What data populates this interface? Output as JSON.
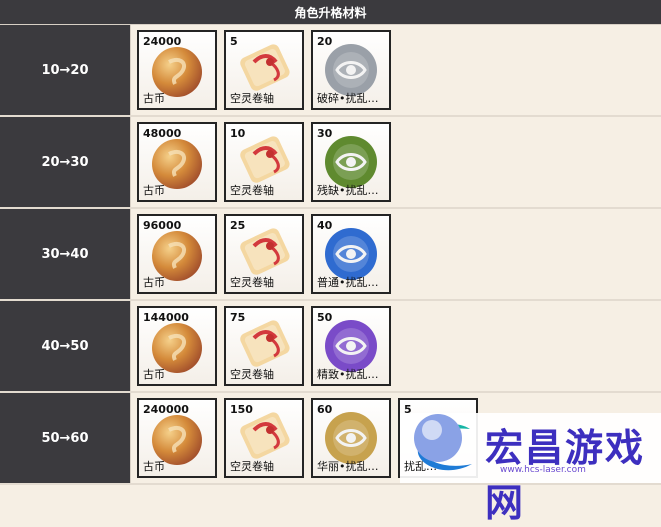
{
  "header": {
    "title": "角色升格材料"
  },
  "rows": [
    {
      "label": "10→20",
      "items": [
        {
          "count": "24000",
          "name": "古币",
          "icon": "coin-icon"
        },
        {
          "count": "5",
          "name": "空灵卷轴",
          "icon": "scroll-icon"
        },
        {
          "count": "20",
          "name": "破碎•扰乱…",
          "icon": "seal-icon",
          "color": "#9aa0a8"
        }
      ]
    },
    {
      "label": "20→30",
      "items": [
        {
          "count": "48000",
          "name": "古币",
          "icon": "coin-icon"
        },
        {
          "count": "10",
          "name": "空灵卷轴",
          "icon": "scroll-icon"
        },
        {
          "count": "30",
          "name": "残缺•扰乱…",
          "icon": "seal-icon",
          "color": "#5f8a2f"
        }
      ]
    },
    {
      "label": "30→40",
      "items": [
        {
          "count": "96000",
          "name": "古币",
          "icon": "coin-icon"
        },
        {
          "count": "25",
          "name": "空灵卷轴",
          "icon": "scroll-icon"
        },
        {
          "count": "40",
          "name": "普通•扰乱…",
          "icon": "seal-icon",
          "color": "#2f6bd0"
        }
      ]
    },
    {
      "label": "40→50",
      "items": [
        {
          "count": "144000",
          "name": "古币",
          "icon": "coin-icon"
        },
        {
          "count": "75",
          "name": "空灵卷轴",
          "icon": "scroll-icon"
        },
        {
          "count": "50",
          "name": "精致•扰乱…",
          "icon": "seal-icon",
          "color": "#7a4bc8"
        }
      ]
    },
    {
      "label": "50→60",
      "items": [
        {
          "count": "240000",
          "name": "古币",
          "icon": "coin-icon"
        },
        {
          "count": "150",
          "name": "空灵卷轴",
          "icon": "scroll-icon"
        },
        {
          "count": "60",
          "name": "华丽•扰乱…",
          "icon": "seal-icon",
          "color": "#c7a24e"
        },
        {
          "count": "5",
          "name": "扰乱…",
          "icon": "orb-icon",
          "color": "#8aa2e6"
        }
      ]
    }
  ],
  "watermark": {
    "brand": "宏昌游戏网",
    "url": "www.hcs-laser.com"
  }
}
